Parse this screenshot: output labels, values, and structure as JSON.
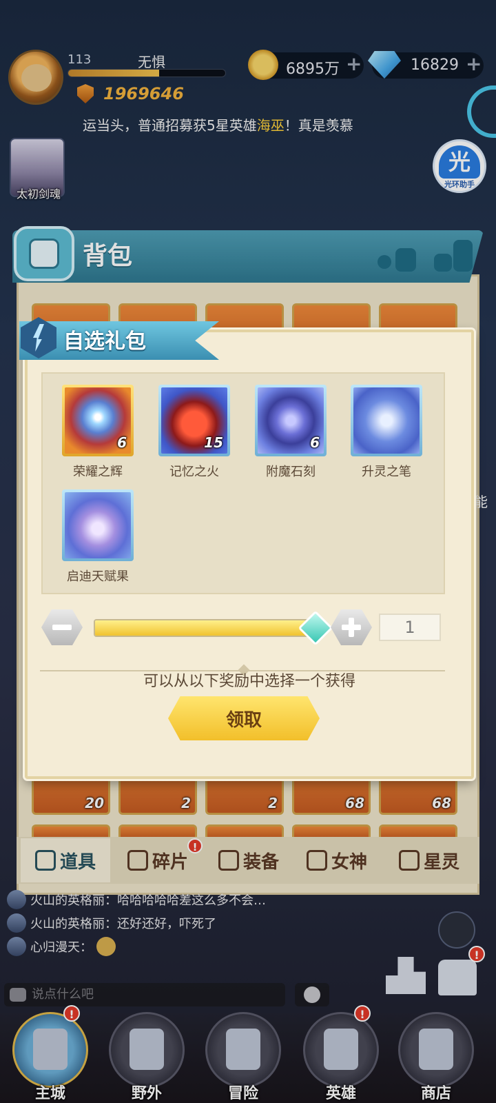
{
  "hud": {
    "level": "113",
    "player_name": "无惧",
    "exp_progress": 0.58,
    "power": "1969646",
    "coins": "6895万",
    "gems": "16829",
    "plus": "+"
  },
  "marquee": {
    "prefix": "运当头，普通招募获5星英雄",
    "hero": "海巫",
    "suffix": "！真是羡慕"
  },
  "halo_assistant": {
    "glyph": "光",
    "label": "光环助手"
  },
  "hero_portrait": {
    "label": "太初剑魂"
  },
  "bag": {
    "title": "背包",
    "bottom_tiles": [
      {
        "count": "20"
      },
      {
        "count": "2"
      },
      {
        "count": "2"
      },
      {
        "count": "68"
      },
      {
        "count": "68"
      }
    ],
    "tabs": [
      {
        "label": "道具",
        "active": true,
        "badge": ""
      },
      {
        "label": "碎片",
        "active": false,
        "badge": "!"
      },
      {
        "label": "装备",
        "active": false,
        "badge": ""
      },
      {
        "label": "女神",
        "active": false,
        "badge": ""
      },
      {
        "label": "星灵",
        "active": false,
        "badge": ""
      }
    ]
  },
  "dialog": {
    "title": "自选礼包",
    "items": [
      {
        "name": "荣耀之辉",
        "qty": "6",
        "frame": "gold",
        "icon": "orb-icon"
      },
      {
        "name": "记忆之火",
        "qty": "15",
        "frame": "blue",
        "icon": "fire-icon"
      },
      {
        "name": "附魔石刻",
        "qty": "6",
        "frame": "blue",
        "icon": "rune-stone-icon"
      },
      {
        "name": "升灵之笔",
        "qty": "",
        "frame": "blue",
        "icon": "quill-icon"
      },
      {
        "name": "启迪天赋果",
        "qty": "",
        "frame": "blue",
        "icon": "fruit-icon"
      }
    ],
    "slider_fraction": 1.0,
    "quantity": "1",
    "hint": "可以从以下奖励中选择一个获得",
    "claim_label": "领取"
  },
  "chat": {
    "messages": [
      {
        "text": "火山的英格丽：哈哈哈哈哈差这么多不会…"
      },
      {
        "text": "火山的英格丽：还好还好，吓死了"
      },
      {
        "text": "心归漫天："
      }
    ],
    "input_placeholder": "说点什么吧"
  },
  "nav": {
    "items": [
      {
        "label": "主城",
        "active": true,
        "badge": "!"
      },
      {
        "label": "野外",
        "active": false,
        "badge": ""
      },
      {
        "label": "冒险",
        "active": false,
        "badge": ""
      },
      {
        "label": "英雄",
        "active": false,
        "badge": "!"
      },
      {
        "label": "商店",
        "active": false,
        "badge": ""
      }
    ]
  },
  "side_label": "能",
  "colors": {
    "accent_gold": "#f2bf2a",
    "ribbon_blue": "#3b8fb1",
    "badge_red": "#e33a2a",
    "highlight_yellow": "#ffd23b"
  }
}
